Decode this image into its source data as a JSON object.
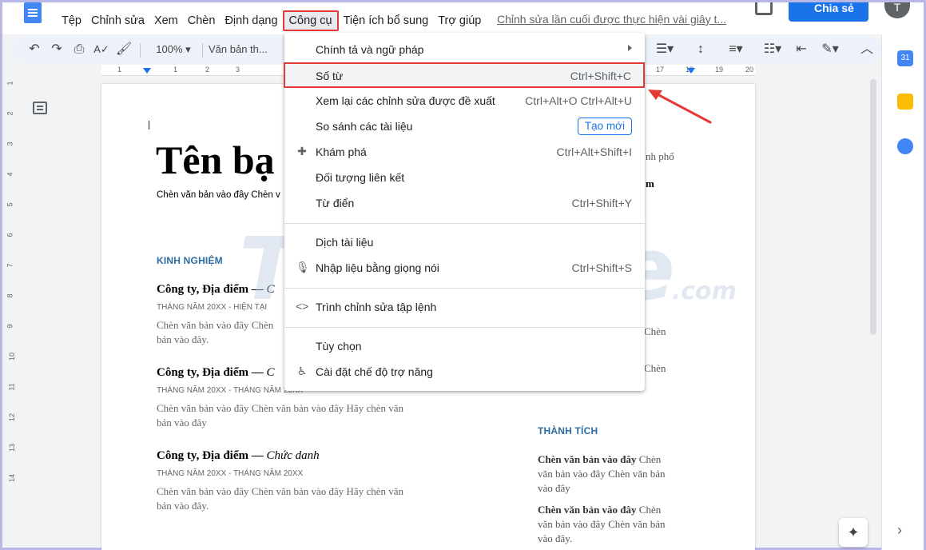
{
  "menubar": {
    "items": [
      "Tệp",
      "Chỉnh sửa",
      "Xem",
      "Chèn",
      "Định dạng",
      "Công cụ",
      "Tiện ích bổ sung",
      "Trợ giúp"
    ],
    "last_edit": "Chỉnh sửa lần cuối được thực hiện vài giây t...",
    "share_label": "Chia sẻ",
    "avatar_letter": "T"
  },
  "toolbar": {
    "zoom": "100%",
    "style": "Văn bản th..."
  },
  "ruler": {
    "numbers": [
      "1",
      "1",
      "2",
      "3",
      "17",
      "18",
      "19",
      "20"
    ],
    "vertical": [
      "1",
      "2",
      "3",
      "4",
      "5",
      "6",
      "7",
      "8",
      "9",
      "10",
      "11",
      "12",
      "13",
      "14"
    ]
  },
  "document": {
    "title": "Tên bạ",
    "subtitle": "Chèn văn bản vào đây Chèn v",
    "section_experience": "KINH NGHIỆM",
    "jobs": [
      {
        "title": "Công ty, Địa điểm — ",
        "role": "C",
        "date": "THÁNG NĂM 20XX - HIỆN TẠI",
        "desc": "Chèn văn bản vào đây Chèn",
        "desc2": "bản vào đây."
      },
      {
        "title": "Công ty, Địa điểm — ",
        "role": "C",
        "date": "THÁNG NĂM 20XX - THÁNG NĂM 20XX",
        "desc": "Chèn văn bản vào đây Chèn văn bản vào đây Hãy chèn văn",
        "desc2": "bản vào đây"
      },
      {
        "title": "Công ty, Địa điểm — ",
        "role": "Chức danh",
        "date": "THÁNG NĂM 20XX - THÁNG NĂM 20XX",
        "desc": "Chèn văn bản vào đây Chèn văn bản vào đây Hãy chèn văn",
        "desc2": "bản vào đây."
      }
    ],
    "side_partial": [
      "nh phố",
      "m",
      "Chèn",
      "Chèn"
    ],
    "section_achievements": "THÀNH TÍCH",
    "achievements": [
      {
        "bold": "Chèn văn bản vào đây",
        "line1": " Chèn",
        "line2": "văn bản vào đây Chèn văn bản",
        "line3": "vào đây"
      },
      {
        "bold": "Chèn văn bản vào đây",
        "line1": " Chèn",
        "line2": "văn bản vào đây Chèn văn bản",
        "line3": "vào đây."
      }
    ]
  },
  "watermark": {
    "main": "TipsMake",
    "suffix": ".com"
  },
  "tools_menu": {
    "items": [
      {
        "label": "Chính tả và ngữ pháp",
        "shortcut": ""
      },
      {
        "label": "Số từ",
        "shortcut": "Ctrl+Shift+C"
      },
      {
        "label": "Xem lại các chỉnh sửa được đề xuất",
        "shortcut": "Ctrl+Alt+O Ctrl+Alt+U"
      },
      {
        "label": "So sánh các tài liệu",
        "shortcut": "",
        "badge": "Tạo mới"
      },
      {
        "label": "Khám phá",
        "shortcut": "Ctrl+Alt+Shift+I"
      },
      {
        "label": "Đối tượng liên kết",
        "shortcut": ""
      },
      {
        "label": "Từ điển",
        "shortcut": "Ctrl+Shift+Y"
      },
      {
        "label": "Dịch tài liệu",
        "shortcut": ""
      },
      {
        "label": "Nhập liệu bằng giọng nói",
        "shortcut": "Ctrl+Shift+S"
      },
      {
        "label": "Trình chỉnh sửa tập lệnh",
        "shortcut": ""
      },
      {
        "label": "Tùy chọn",
        "shortcut": ""
      },
      {
        "label": "Cài đặt chế độ trợ năng",
        "shortcut": ""
      }
    ]
  },
  "colors": {
    "accent": "#1a73e8",
    "highlight_border": "#e53935",
    "section_heading": "#2d6ca2"
  }
}
